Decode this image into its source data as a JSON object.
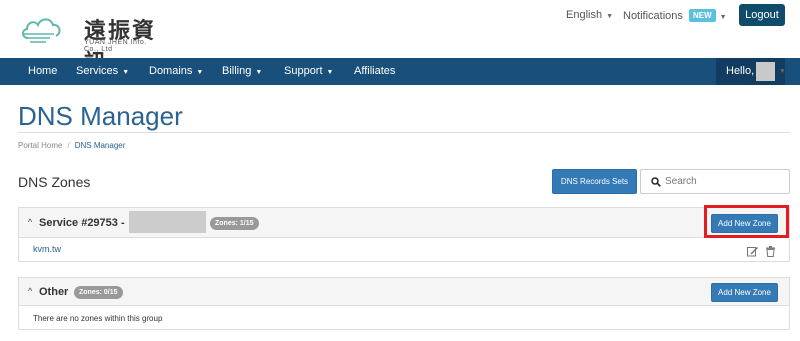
{
  "brand": {
    "name_cn": "遠振資訊",
    "name_en": "YUAN JHEN Info. Co., Ltd",
    "color": "#5fb7a9"
  },
  "topbar": {
    "language": "English",
    "notifications": "Notifications",
    "new_badge": "NEW",
    "logout": "Logout"
  },
  "nav": {
    "items": [
      "Home",
      "Services",
      "Domains",
      "Billing",
      "Support",
      "Affiliates"
    ],
    "hello": "Hello,"
  },
  "page": {
    "title": "DNS Manager",
    "breadcrumb": [
      "Portal Home",
      "DNS Manager"
    ]
  },
  "zones": {
    "heading": "DNS Zones",
    "records_button": "DNS Records Sets",
    "search_placeholder": "Search"
  },
  "groups": [
    {
      "name": "Service #29753 -",
      "badge": "Zones: 1/15",
      "add_button": "Add New Zone",
      "rows": [
        "kvm.tw"
      ]
    },
    {
      "name": "Other",
      "badge": "Zones: 0/15",
      "add_button": "Add New Zone",
      "empty_text": "There are no zones within this group"
    }
  ],
  "colors": {
    "navbar": "#184f7b",
    "primary": "#337ab7",
    "title": "#2a6291",
    "highlight": "#e31b23"
  }
}
